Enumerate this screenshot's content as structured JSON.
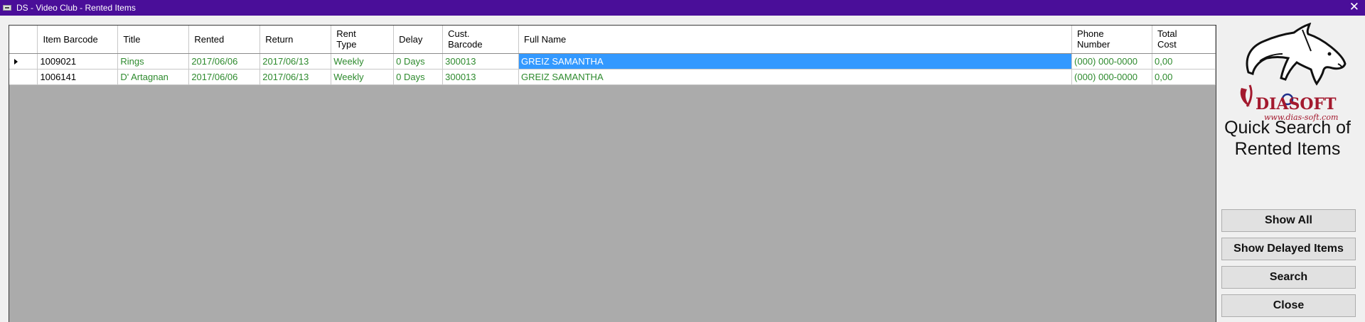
{
  "window": {
    "title": "DS - Video Club - Rented Items",
    "close_glyph": "✕"
  },
  "grid": {
    "columns": [
      {
        "label": "Item Barcode"
      },
      {
        "label": "Title"
      },
      {
        "label": "Rented"
      },
      {
        "label": "Return"
      },
      {
        "label": "Rent\nType"
      },
      {
        "label": "Delay"
      },
      {
        "label": "Cust.\nBarcode"
      },
      {
        "label": "Full Name"
      },
      {
        "label": "Phone\nNumber"
      },
      {
        "label": "Total\nCost"
      }
    ],
    "rows": [
      {
        "current": true,
        "cells": [
          "1009021",
          "Rings",
          "2017/06/06",
          "2017/06/13",
          "Weekly",
          "0 Days",
          "300013",
          "GREIZ SAMANTHA",
          "(000) 000-0000",
          "0,00"
        ]
      },
      {
        "current": false,
        "cells": [
          "1006141",
          "D' Artagnan",
          "2017/06/06",
          "2017/06/13",
          "Weekly",
          "0 Days",
          "300013",
          "GREIZ SAMANTHA",
          "(000) 000-0000",
          "0,00"
        ]
      }
    ]
  },
  "sidebar": {
    "logo_text": "DIASOFT",
    "logo_url_text": "www.dias-soft.com",
    "heading": "Quick Search of Rented Items",
    "buttons": {
      "show_all": "Show All",
      "show_delayed": "Show Delayed Items",
      "search": "Search",
      "close": "Close"
    }
  },
  "colors": {
    "titlebar": "#4a0e99",
    "selection": "#3399ff",
    "data_text": "#2d8a2d",
    "grid_bg": "#ababab"
  }
}
